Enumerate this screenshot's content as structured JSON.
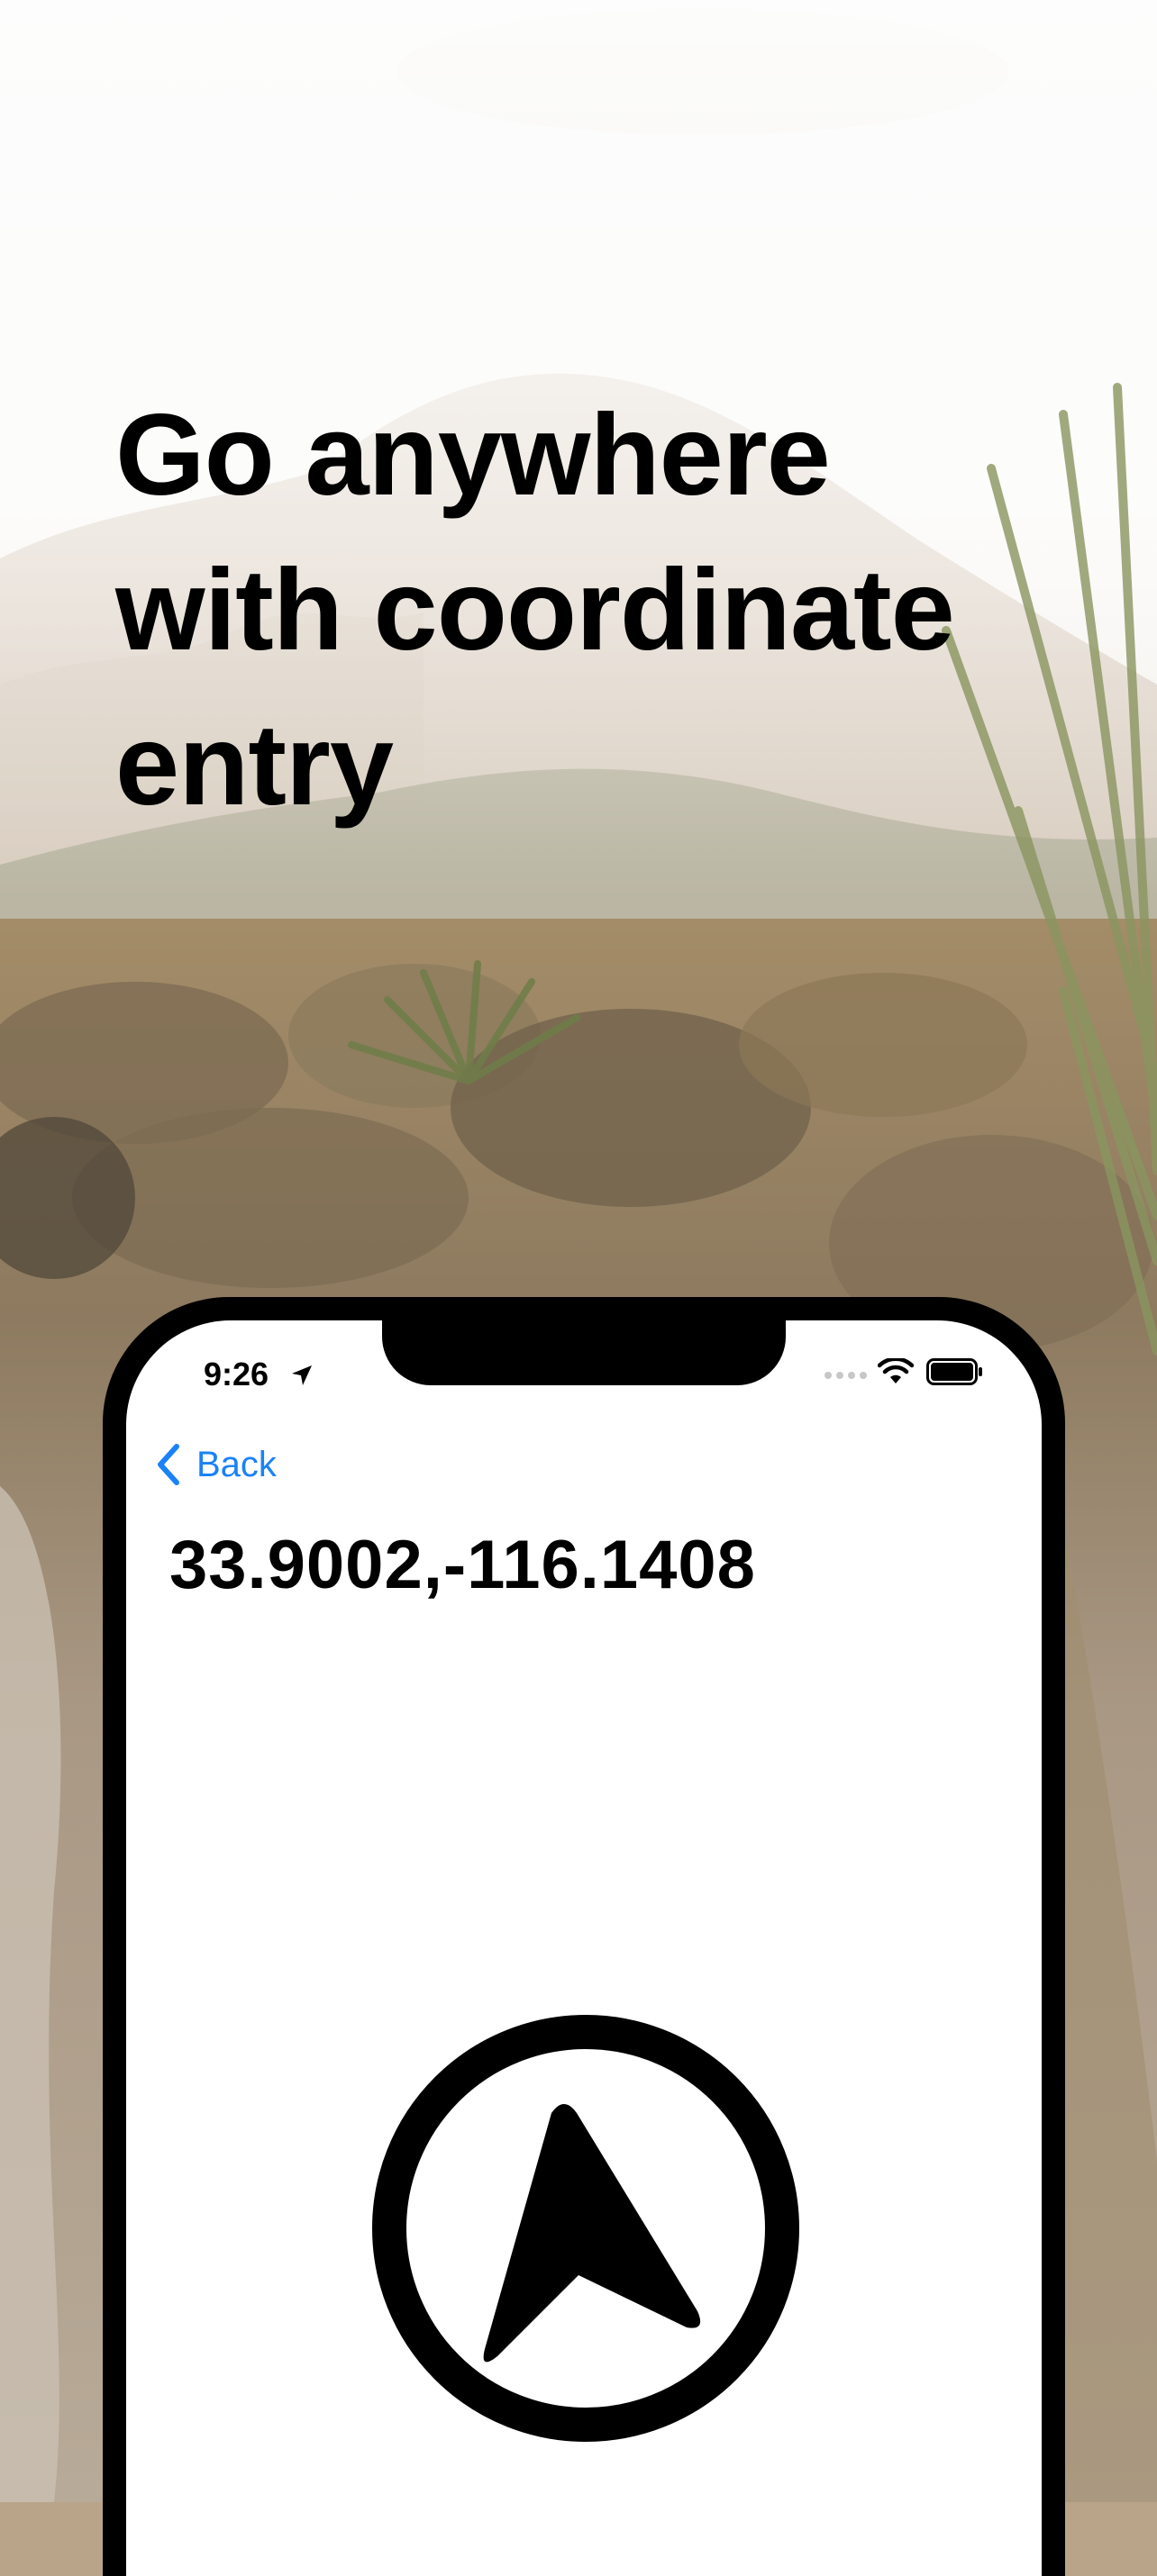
{
  "promo": {
    "headline": "Go anywhere with coordinate entry"
  },
  "status_bar": {
    "time": "9:26",
    "location_icon": "location-arrow-icon",
    "signal_icon": "signal-dots-icon",
    "wifi_icon": "wifi-icon",
    "battery_icon": "battery-icon"
  },
  "nav": {
    "back_label": "Back",
    "back_icon": "chevron-left-icon"
  },
  "main": {
    "coordinates": "33.9002,-116.1408",
    "compass_icon": "navigation-arrow-icon"
  },
  "colors": {
    "accent": "#1a82f7",
    "text": "#000000",
    "phone_frame": "#000000",
    "screen_bg": "#ffffff"
  }
}
